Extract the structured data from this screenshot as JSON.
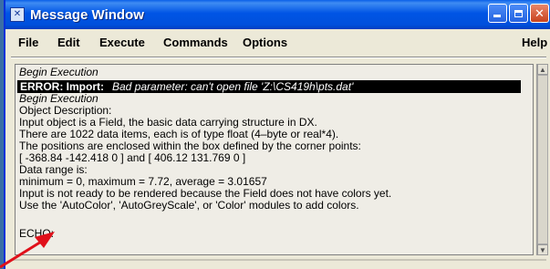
{
  "window": {
    "title": "Message Window",
    "icon": "dx-window-icon"
  },
  "menu": {
    "file": "File",
    "edit": "Edit",
    "execute": "Execute",
    "commands": "Commands",
    "options": "Options",
    "help": "Help"
  },
  "messages": {
    "begin1": "Begin Execution",
    "error_label": "ERROR: Import:",
    "error_msg": "Bad parameter: can't open file 'Z:\\CS419h\\pts.dat'",
    "begin2": "Begin Execution",
    "l1": "Object Description:",
    "l2": "Input object is a Field, the basic data carrying structure in DX.",
    "l3": "There are 1022 data items, each is of type float (4–byte or real*4).",
    "l4": "The positions are enclosed within the box defined by the corner points:",
    "l5": "[ -368.84 -142.418 0 ] and [ 406.12 131.769 0 ]",
    "l6": "Data range is:",
    "l7": "minimum = 0, maximum = 7.72, average = 3.01657",
    "l8": "Input is not ready to be rendered because the Field does not have colors yet.",
    "l9": "Use the 'AutoColor', 'AutoGreyScale', or 'Color' modules to add colors.",
    "echo": "ECHO:"
  },
  "colors": {
    "titlebar": "#0055E5",
    "annotation_arrow": "#E0101A",
    "error_bg": "#000000"
  }
}
